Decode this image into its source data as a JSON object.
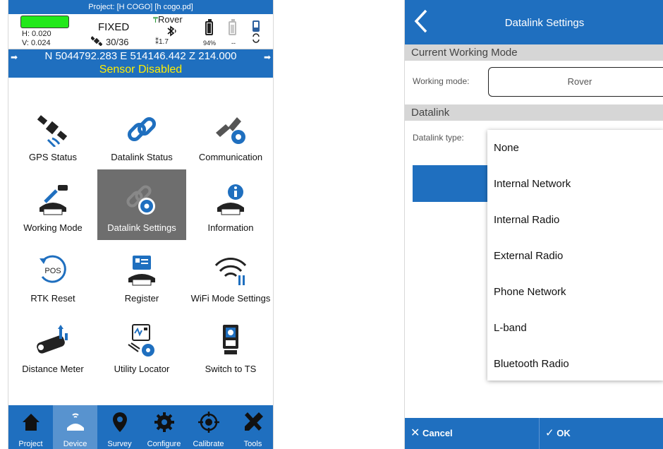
{
  "left_screen": {
    "project_title": "Project: [H COGO] [h cogo.pd]",
    "status": {
      "h_precision": "H: 0.020",
      "v_precision": "V: 0.024",
      "solution": "FIXED",
      "satellites": "30/36",
      "mode": "Rover",
      "pdop": "1.7",
      "battery_1": "94%",
      "battery_2": "--"
    },
    "coords": "N 5044792.283 E 514146.442 Z 214.000",
    "sensor_status": "Sensor Disabled",
    "tiles": [
      {
        "label": "GPS Status"
      },
      {
        "label": "Datalink Status"
      },
      {
        "label": "Communication"
      },
      {
        "label": "Working Mode"
      },
      {
        "label": "Datalink Settings"
      },
      {
        "label": "Information"
      },
      {
        "label": "RTK Reset",
        "icon_text": "POS"
      },
      {
        "label": "Register"
      },
      {
        "label": "WiFi Mode Settings"
      },
      {
        "label": "Distance Meter"
      },
      {
        "label": "Utility Locator"
      },
      {
        "label": "Switch to TS"
      }
    ],
    "nav": [
      {
        "label": "Project"
      },
      {
        "label": "Device"
      },
      {
        "label": "Survey"
      },
      {
        "label": "Configure"
      },
      {
        "label": "Calibrate"
      },
      {
        "label": "Tools"
      }
    ],
    "colors": {
      "primary": "#1f6fbf",
      "sensor_text": "#ffee00",
      "fix_indicator": "#22e81a",
      "selected_tile": "#6e6e6e"
    }
  },
  "right_screen": {
    "title": "Datalink Settings",
    "section_working_mode": "Current Working Mode",
    "working_mode_label": "Working mode:",
    "working_mode_value": "Rover",
    "section_datalink": "Datalink",
    "datalink_type_label": "Datalink type:",
    "dropdown_options": [
      "None",
      "Internal Network",
      "Internal Radio",
      "External Radio",
      "Phone Network",
      "L-band",
      "Bluetooth Radio"
    ],
    "cancel_label": "Cancel",
    "ok_label": "OK"
  }
}
